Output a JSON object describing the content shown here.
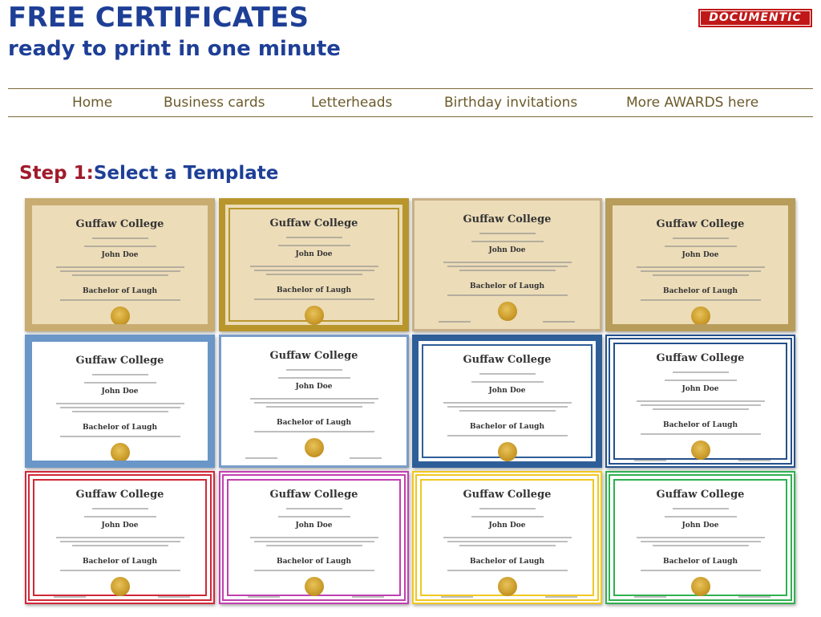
{
  "header": {
    "title": "FREE CERTIFICATES",
    "subtitle": "ready to print in one minute",
    "logo": "DOCUMENTIC"
  },
  "nav": {
    "items": [
      "Home",
      "Business cards",
      "Letterheads",
      "Birthday invitations",
      "More AWARDS here"
    ]
  },
  "step": {
    "number": "Step 1:",
    "label": "Select a Template"
  },
  "certificate": {
    "college": "Guffaw College",
    "name": "John Doe",
    "degree": "Bachelor of Laugh"
  },
  "templates": [
    {
      "name": "beige-pattern",
      "bg": "#ecdcb8",
      "border": "#c8ac70",
      "style": "pattern"
    },
    {
      "name": "gold-frame",
      "bg": "#ecdcb8",
      "border": "#b8962c",
      "style": "frame"
    },
    {
      "name": "beige-corners",
      "bg": "#ecdcb8",
      "border": "#c8b088",
      "style": "corners"
    },
    {
      "name": "gold-greek",
      "bg": "#ecdcb8",
      "border": "#b89c5a",
      "style": "pattern"
    },
    {
      "name": "blue-pattern",
      "bg": "#ffffff",
      "border": "#6a96c8",
      "style": "pattern"
    },
    {
      "name": "blue-corners",
      "bg": "#ffffff",
      "border": "#7a9cc8",
      "style": "corners"
    },
    {
      "name": "blue-thick",
      "bg": "#ffffff",
      "border": "#2e5e98",
      "style": "frame"
    },
    {
      "name": "navy-double",
      "bg": "#ffffff",
      "border": "#24508c",
      "style": "double"
    },
    {
      "name": "red-double",
      "bg": "#ffffff",
      "border": "#d02838",
      "style": "double"
    },
    {
      "name": "magenta-double",
      "bg": "#ffffff",
      "border": "#c040b0",
      "style": "double"
    },
    {
      "name": "yellow-double",
      "bg": "#ffffff",
      "border": "#f0c820",
      "style": "double"
    },
    {
      "name": "green-double",
      "bg": "#ffffff",
      "border": "#30b050",
      "style": "double"
    }
  ]
}
